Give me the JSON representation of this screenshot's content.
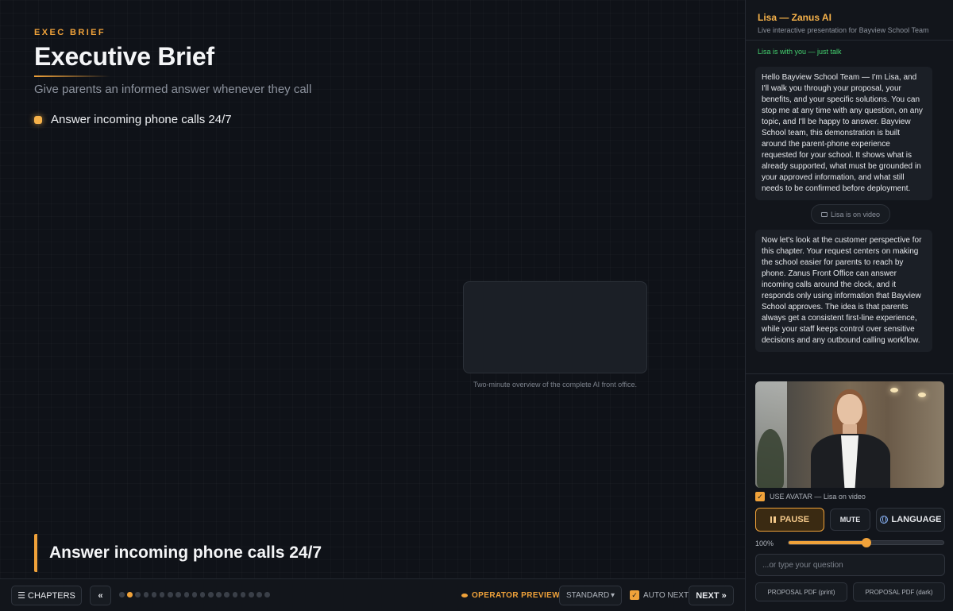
{
  "stage": {
    "eyebrow": "EXEC BRIEF",
    "title": "Executive Brief",
    "subtitle": "Give parents an informed answer whenever they call",
    "bullet": "Answer incoming phone calls 24/7",
    "video_caption": "Two-minute overview of the complete AI front office.",
    "callout": "Answer incoming phone calls 24/7"
  },
  "bottombar": {
    "chapters_label": "☰ CHAPTERS",
    "prev_label": "«",
    "progress": {
      "total_chapters": 19,
      "current_chapter": 2
    },
    "operator_preview": "OPERATOR PREVIEW",
    "mode_select": "STANDARD",
    "auto_next_label": "AUTO NEXT",
    "auto_next_checked": true,
    "next_label": "NEXT »"
  },
  "sidebar": {
    "title": "Lisa — Zanus AI",
    "subtitle": "Live interactive presentation for Bayview School Team",
    "status": "Lisa is with you — just talk",
    "messages": [
      "Hello Bayview School Team — I'm Lisa, and I'll walk you through your proposal, your benefits, and your specific solutions. You can stop me at any time with any question, on any topic, and I'll be happy to answer. Bayview School team, this demonstration is built around the parent-phone experience requested for your school. It shows what is already supported, what must be grounded in your approved information, and what still needs to be confirmed before deployment.",
      "Now let's look at the customer perspective for this chapter. Your request centers on making the school easier for parents to reach by phone. Zanus Front Office can answer incoming calls around the clock, and it responds only using information that Bayview School approves. The idea is that parents always get a consistent first-line experience, while your staff keeps control over sensitive decisions and any outbound calling workflow."
    ],
    "video_pill": "Lisa is on video",
    "use_avatar_label": "USE AVATAR — Lisa on video",
    "use_avatar_checked": true,
    "pause_label": "PAUSE",
    "mute_label": "MUTE",
    "language_label": "LANGUAGE",
    "volume_label": "100%",
    "volume_fraction": 0.5,
    "ask_placeholder": "...or type your question",
    "pdf_print_label": "PROPOSAL PDF (print)",
    "pdf_dark_label": "PROPOSAL PDF (dark)",
    "colors": {
      "accent": "#f0a23a",
      "status_green": "#44d06f",
      "background": "#0e1117"
    }
  }
}
